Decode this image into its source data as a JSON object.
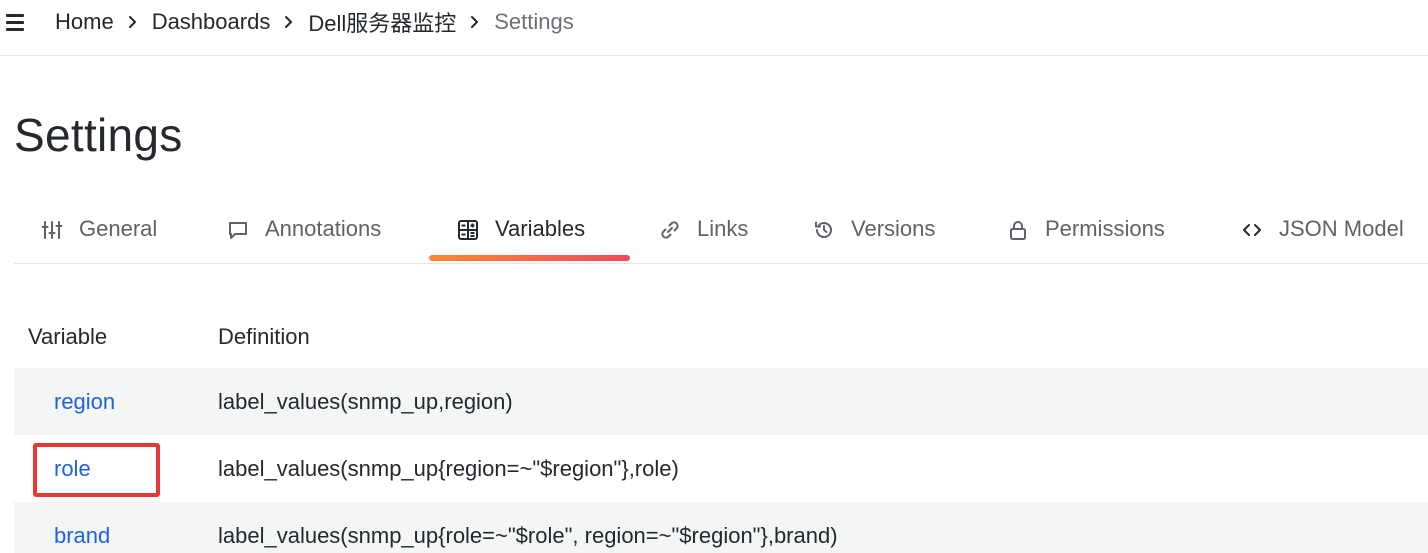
{
  "breadcrumb": {
    "items": [
      "Home",
      "Dashboards",
      "Dell服务器监控"
    ],
    "current": "Settings"
  },
  "page": {
    "title": "Settings"
  },
  "tabs": [
    {
      "label": "General",
      "icon": "sliders-icon"
    },
    {
      "label": "Annotations",
      "icon": "comment-icon"
    },
    {
      "label": "Variables",
      "icon": "calculator-icon",
      "active": true
    },
    {
      "label": "Links",
      "icon": "link-icon"
    },
    {
      "label": "Versions",
      "icon": "history-icon"
    },
    {
      "label": "Permissions",
      "icon": "lock-icon"
    },
    {
      "label": "JSON Model",
      "icon": "code-brackets-icon"
    }
  ],
  "table": {
    "headers": {
      "variable": "Variable",
      "definition": "Definition"
    },
    "rows": [
      {
        "name": "region",
        "definition": "label_values(snmp_up,region)"
      },
      {
        "name": "role",
        "definition": "label_values(snmp_up{region=~\"$region\"},role)",
        "highlighted": true
      },
      {
        "name": "brand",
        "definition": "label_values(snmp_up{role=~\"$role\", region=~\"$region\"},brand)"
      }
    ]
  },
  "colors": {
    "link": "#1f62e0",
    "accent_gradient_start": "#ff8833",
    "accent_gradient_end": "#f2495c",
    "highlight_box": "#e53935"
  }
}
